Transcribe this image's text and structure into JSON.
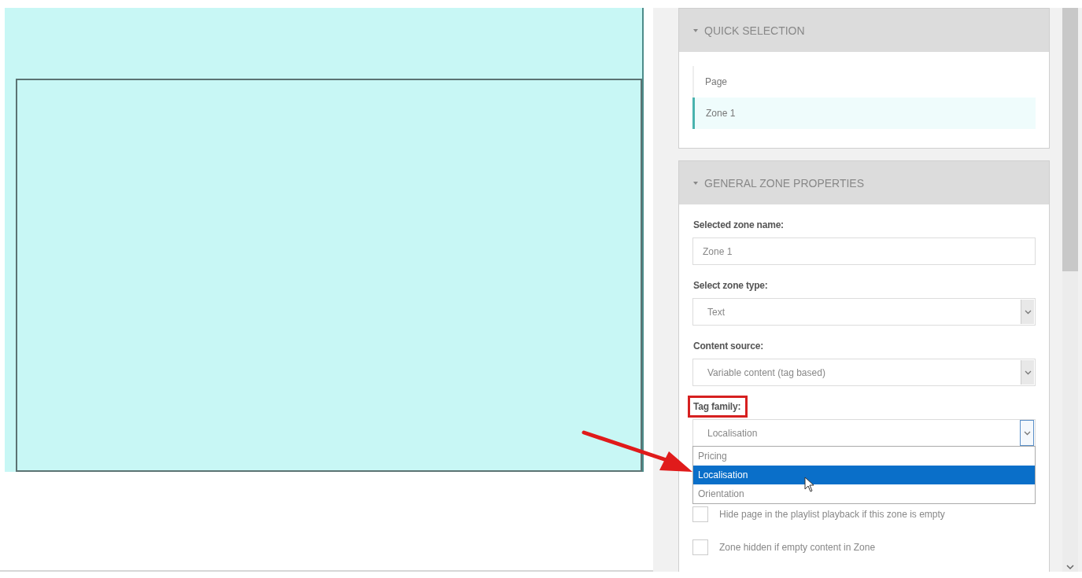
{
  "quick_selection": {
    "title": "QUICK SELECTION",
    "expanded": true,
    "items": [
      {
        "label": "Page",
        "selected": false
      },
      {
        "label": "Zone 1",
        "selected": true
      }
    ]
  },
  "general_zone_properties": {
    "title": "GENERAL ZONE PROPERTIES",
    "expanded": true,
    "fields": [
      {
        "kind": "text",
        "label": "Selected zone name:",
        "value": "Zone 1",
        "highlighted": false
      },
      {
        "kind": "select",
        "label": "Select zone type:",
        "value": "Text",
        "highlighted": false
      },
      {
        "kind": "select",
        "label": "Content source:",
        "value": "Variable content (tag based)",
        "highlighted": false
      },
      {
        "kind": "select",
        "label": "Tag family:",
        "value": "Localisation",
        "highlighted": true,
        "open": true,
        "options": [
          {
            "label": "Pricing",
            "selected": false
          },
          {
            "label": "Localisation",
            "selected": true
          },
          {
            "label": "Orientation",
            "selected": false
          }
        ]
      }
    ],
    "checkboxes": [
      {
        "label": "Hide page in the playlist playback if this zone is empty",
        "checked": false
      },
      {
        "label": "Zone hidden if empty content in Zone",
        "checked": false
      }
    ]
  }
}
